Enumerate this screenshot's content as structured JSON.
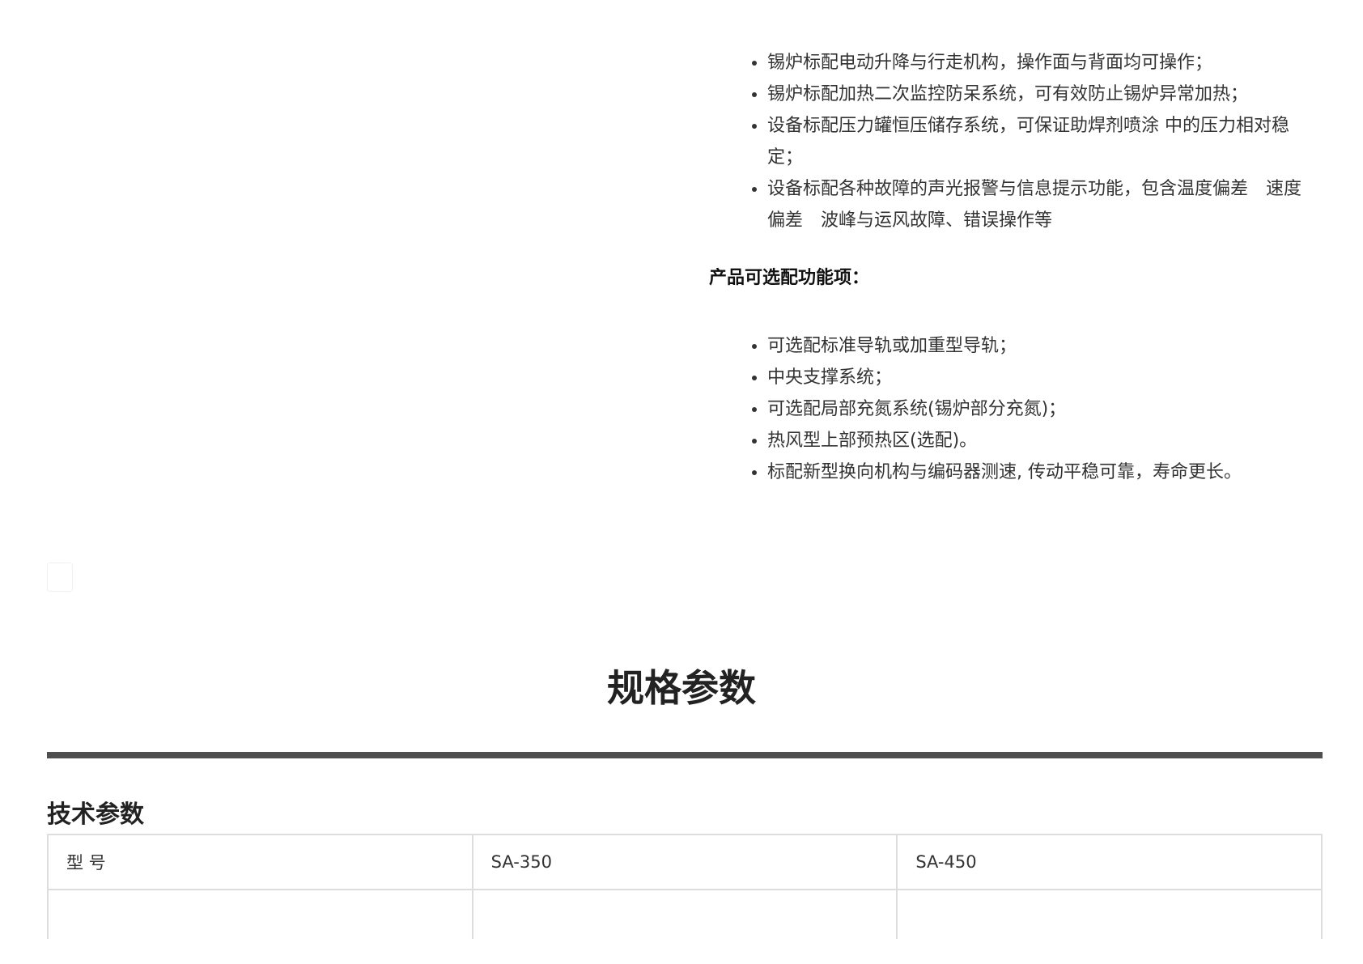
{
  "standard_features": [
    " 锡炉标配电动升降与行走机构，操作面与背面均可操作；",
    "锡炉标配加热二次监控防呆系统，可有效防止锡炉异常加热；",
    "设备标配压力罐恒压储存系统，可保证助焊剂喷涂 中的压力相对稳定；",
    "设备标配各种故障的声光报警与信息提示功能，包含温度偏差　速度偏差　波峰与运风故障、错误操作等"
  ],
  "optional_title": "产品可选配功能项：",
  "optional_features": [
    "可选配标准导轨或加重型导轨；",
    "中央支撑系统；",
    "可选配局部充氮系统(锡炉部分充氮)；",
    "热风型上部预热区(选配)。",
    "标配新型换向机构与编码器测速, 传动平稳可靠，寿命更长。"
  ],
  "spec_heading": "规格参数",
  "tech_heading": "技术参数",
  "table": {
    "header": [
      "型 号",
      "SA-350",
      "SA-450"
    ]
  }
}
